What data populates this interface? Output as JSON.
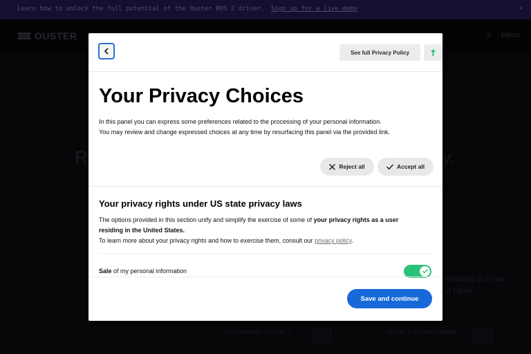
{
  "banner": {
    "text": "Learn how to unlock the full potential of the Ouster ROS 2 driver.",
    "link": "Sign up for a live demo",
    "close": "×"
  },
  "site": {
    "logo": "OUSTER",
    "menu_label": "Menu",
    "menu_icon": "≡"
  },
  "background": {
    "hero_left": "R",
    "hero_right": "y.",
    "copy_line1": "unlocking in a new",
    "copy_line2": "nd future",
    "card1_line1": "Conversation • Ouster 1",
    "card1_line2": "",
    "card2_line1": "Ouster & SmartRoadWay",
    "card2_line2": ""
  },
  "modal": {
    "policy_button": "See full Privacy Policy",
    "title": "Your Privacy Choices",
    "intro_line1": "In this panel you can express some preferences related to the processing of your personal information.",
    "intro_line2": "You may review and change expressed choices at any time by resurfacing this panel via the provided link.",
    "reject_label": "Reject all",
    "accept_label": "Accept all",
    "section_title": "Your privacy rights under US state privacy laws",
    "section_body_plain": "The options provided in this section unify and simplify the exercise of some of ",
    "section_body_bold": "your privacy rights as a user residing in the United States.",
    "section_body_line2": "To learn more about your privacy rights and how to exercise them, consult our ",
    "section_link": "privacy policy",
    "section_end": ".",
    "sale_bold": "Sale",
    "sale_text": " of my personal information",
    "sale_toggle_on": true,
    "save_label": "Save and continue"
  },
  "colors": {
    "accent_blue": "#1769d9",
    "toggle_green": "#29c276",
    "banner_bg": "#1f1a4a"
  }
}
